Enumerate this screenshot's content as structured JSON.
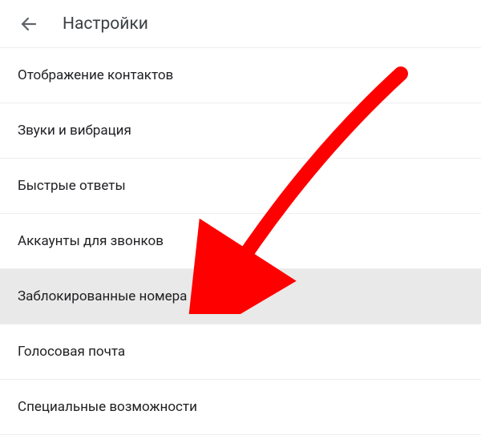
{
  "header": {
    "title": "Настройки"
  },
  "settings": {
    "items": [
      {
        "label": "Отображение контактов",
        "highlighted": false
      },
      {
        "label": "Звуки и вибрация",
        "highlighted": false
      },
      {
        "label": "Быстрые ответы",
        "highlighted": false
      },
      {
        "label": "Аккаунты для звонков",
        "highlighted": false
      },
      {
        "label": "Заблокированные номера",
        "highlighted": true
      },
      {
        "label": "Голосовая почта",
        "highlighted": false
      },
      {
        "label": "Специальные возможности",
        "highlighted": false
      }
    ]
  },
  "annotation": {
    "arrow_color": "#ff0000"
  }
}
